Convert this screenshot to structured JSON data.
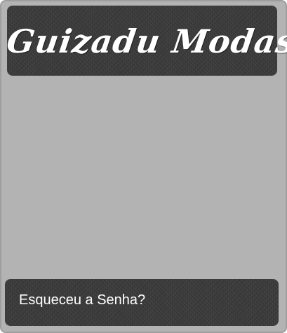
{
  "header": {
    "logo_text": "Guizadu Modas"
  },
  "footer": {
    "forgot_password_link": "Esqueceu a Senha?"
  },
  "colors": {
    "frame_background": "#b3b3b3",
    "panel_background": "#3a3a3a",
    "text": "#ffffff"
  }
}
